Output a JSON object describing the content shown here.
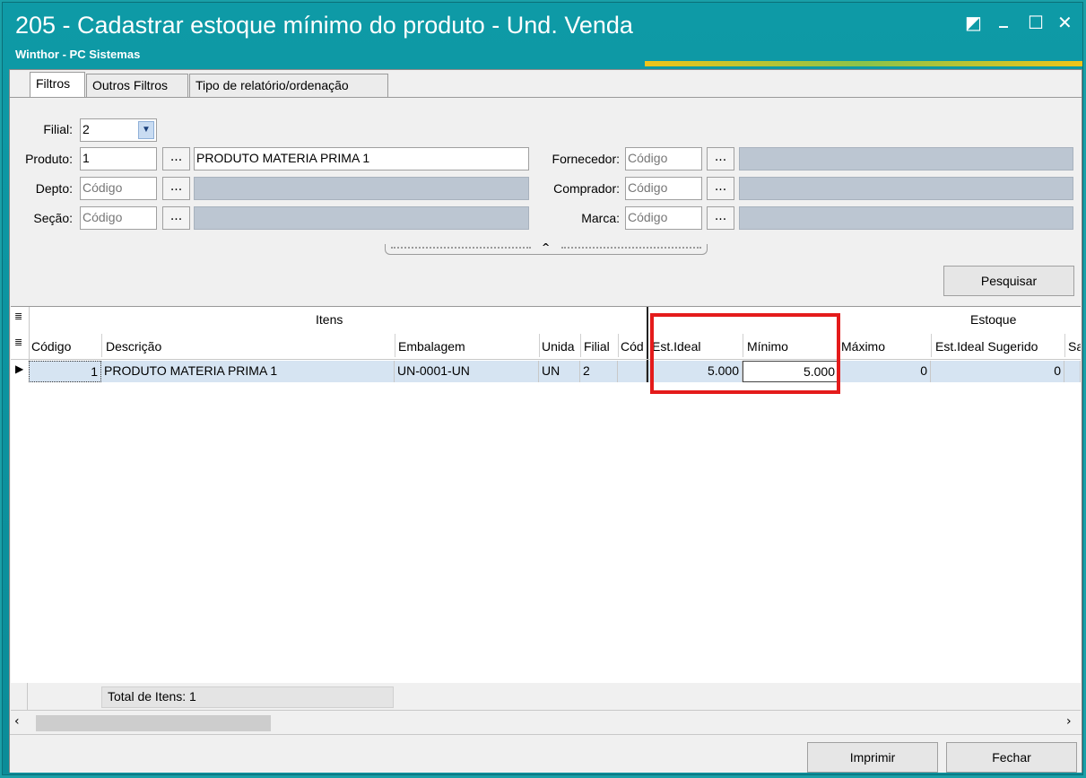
{
  "window": {
    "title": "205 - Cadastrar estoque mínimo do produto - Und. Venda",
    "subtitle": "Winthor - PC Sistemas",
    "controls": [
      "◩",
      "_",
      "☐",
      "✕"
    ]
  },
  "tabs": [
    "Filtros",
    "Outros Filtros",
    "Tipo de relatório/ordenação"
  ],
  "filters": {
    "filial_label": "Filial:",
    "filial_value": "2",
    "produto_label": "Produto:",
    "produto_code": "1",
    "produto_desc": "PRODUTO MATERIA PRIMA 1",
    "depto_label": "Depto:",
    "secao_label": "Seção:",
    "fornecedor_label": "Fornecedor:",
    "comprador_label": "Comprador:",
    "marca_label": "Marca:",
    "code_placeholder": "Código",
    "ellipsis": "...",
    "pesquisar": "Pesquisar"
  },
  "grid": {
    "group_itens": "Itens",
    "group_estoque": "Estoque",
    "columns": [
      "Código",
      "Descrição",
      "Embalagem",
      "Unida",
      "Filial",
      "Cód",
      "Est.Ideal",
      "Mínimo",
      "Máximo",
      "Est.Ideal Sugerido",
      "Sa"
    ],
    "row": [
      "1",
      "PRODUTO MATERIA PRIMA 1",
      "UN-0001-UN",
      "UN",
      "2",
      "",
      "5.000",
      "5.000",
      "0",
      "0",
      ""
    ]
  },
  "footer": {
    "total": "Total de Itens: 1"
  },
  "buttons": {
    "imprimir": "Imprimir",
    "fechar": "Fechar"
  },
  "colors": {
    "titlebar": "#0e9aa6",
    "highlight": "#e41b1b",
    "row_selected": "#d6e4f2"
  }
}
